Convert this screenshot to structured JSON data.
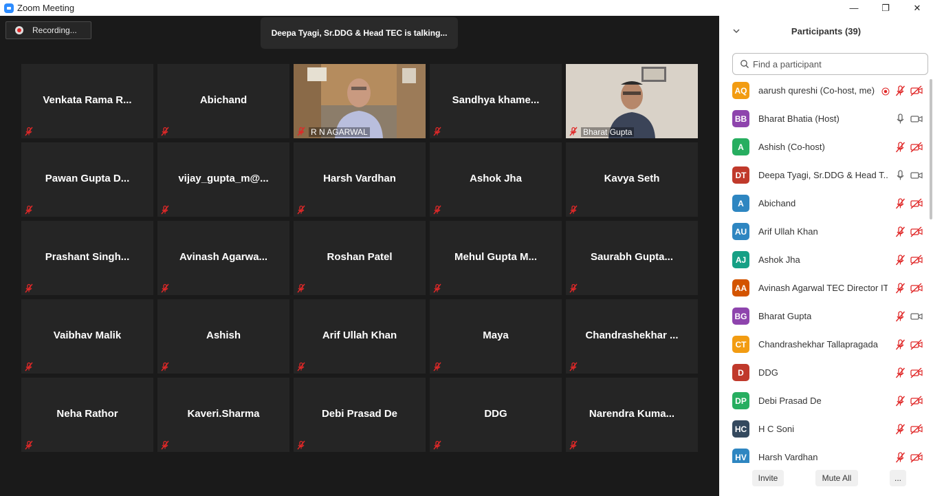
{
  "window": {
    "title": "Zoom Meeting",
    "minimize": "—",
    "maximize": "❐",
    "close": "✕"
  },
  "recording": {
    "label": "Recording..."
  },
  "talking_banner": "Deepa Tyagi, Sr.DDG & Head  TEC is talking...",
  "tiles": [
    {
      "name": "Venkata  Rama  R...",
      "video": false
    },
    {
      "name": "Abichand",
      "video": false
    },
    {
      "name": "R N AGARWAL",
      "video": true
    },
    {
      "name": "Sandhya  khame...",
      "video": false
    },
    {
      "name": "Bharat Gupta",
      "video": true
    },
    {
      "name": "Pawan  Gupta  D...",
      "video": false
    },
    {
      "name": "vijay_gupta_m@...",
      "video": false
    },
    {
      "name": "Harsh Vardhan",
      "video": false
    },
    {
      "name": "Ashok Jha",
      "video": false
    },
    {
      "name": "Kavya Seth",
      "video": false
    },
    {
      "name": "Prashant  Singh...",
      "video": false
    },
    {
      "name": "Avinash  Agarwa...",
      "video": false
    },
    {
      "name": "Roshan Patel",
      "video": false
    },
    {
      "name": "Mehul  Gupta  M...",
      "video": false
    },
    {
      "name": "Saurabh  Gupta...",
      "video": false
    },
    {
      "name": "Vaibhav Malik",
      "video": false
    },
    {
      "name": "Ashish",
      "video": false
    },
    {
      "name": "Arif Ullah Khan",
      "video": false
    },
    {
      "name": "Maya",
      "video": false
    },
    {
      "name": "Chandrashekhar ...",
      "video": false
    },
    {
      "name": "Neha Rathor",
      "video": false
    },
    {
      "name": "Kaveri.Sharma",
      "video": false
    },
    {
      "name": "Debi Prasad De",
      "video": false
    },
    {
      "name": "DDG",
      "video": false
    },
    {
      "name": "Narendra  Kuma...",
      "video": false
    }
  ],
  "participants_panel": {
    "title": "Participants (39)",
    "search_placeholder": "Find a participant",
    "participants": [
      {
        "initials": "AQ",
        "name": "aarush qureshi (Co-host, me)",
        "color": "#f29c12",
        "mic": "muted",
        "cam": "off",
        "recording": true
      },
      {
        "initials": "BB",
        "name": "Bharat Bhatia (Host)",
        "color": "#8e44ad",
        "mic": "on",
        "cam": "on",
        "recording": false
      },
      {
        "initials": "A",
        "name": "Ashish (Co-host)",
        "color": "#27ae60",
        "mic": "muted",
        "cam": "off",
        "recording": false
      },
      {
        "initials": "DT",
        "name": "Deepa Tyagi, Sr.DDG & Head  T...",
        "color": "#c0392b",
        "mic": "on",
        "cam": "on",
        "recording": false
      },
      {
        "initials": "A",
        "name": "Abichand",
        "color": "#2e86c1",
        "mic": "muted",
        "cam": "off",
        "recording": false
      },
      {
        "initials": "AU",
        "name": "Arif Ullah Khan",
        "color": "#2e86c1",
        "mic": "muted",
        "cam": "off",
        "recording": false
      },
      {
        "initials": "AJ",
        "name": "Ashok Jha",
        "color": "#16a085",
        "mic": "muted",
        "cam": "off",
        "recording": false
      },
      {
        "initials": "AA",
        "name": "Avinash Agarwal TEC Director IT",
        "color": "#d35400",
        "mic": "muted",
        "cam": "off",
        "recording": false
      },
      {
        "initials": "BG",
        "name": "Bharat Gupta",
        "color": "#8e44ad",
        "mic": "muted",
        "cam": "on",
        "recording": false
      },
      {
        "initials": "CT",
        "name": "Chandrashekhar Tallapragada",
        "color": "#f29c12",
        "mic": "muted",
        "cam": "off",
        "recording": false
      },
      {
        "initials": "D",
        "name": "DDG",
        "color": "#c0392b",
        "mic": "muted",
        "cam": "off",
        "recording": false
      },
      {
        "initials": "DP",
        "name": "Debi Prasad De",
        "color": "#27ae60",
        "mic": "muted",
        "cam": "off",
        "recording": false
      },
      {
        "initials": "HC",
        "name": "H C Soni",
        "color": "#34495e",
        "mic": "muted",
        "cam": "off",
        "recording": false
      },
      {
        "initials": "HV",
        "name": "Harsh Vardhan",
        "color": "#2e86c1",
        "mic": "muted",
        "cam": "off",
        "recording": false
      }
    ],
    "footer": {
      "invite": "Invite",
      "mute_all": "Mute All",
      "more": "..."
    }
  },
  "colors": {
    "meeting_bg": "#1a1a1a",
    "tile_bg": "#252525",
    "muted_red": "#e02828"
  }
}
